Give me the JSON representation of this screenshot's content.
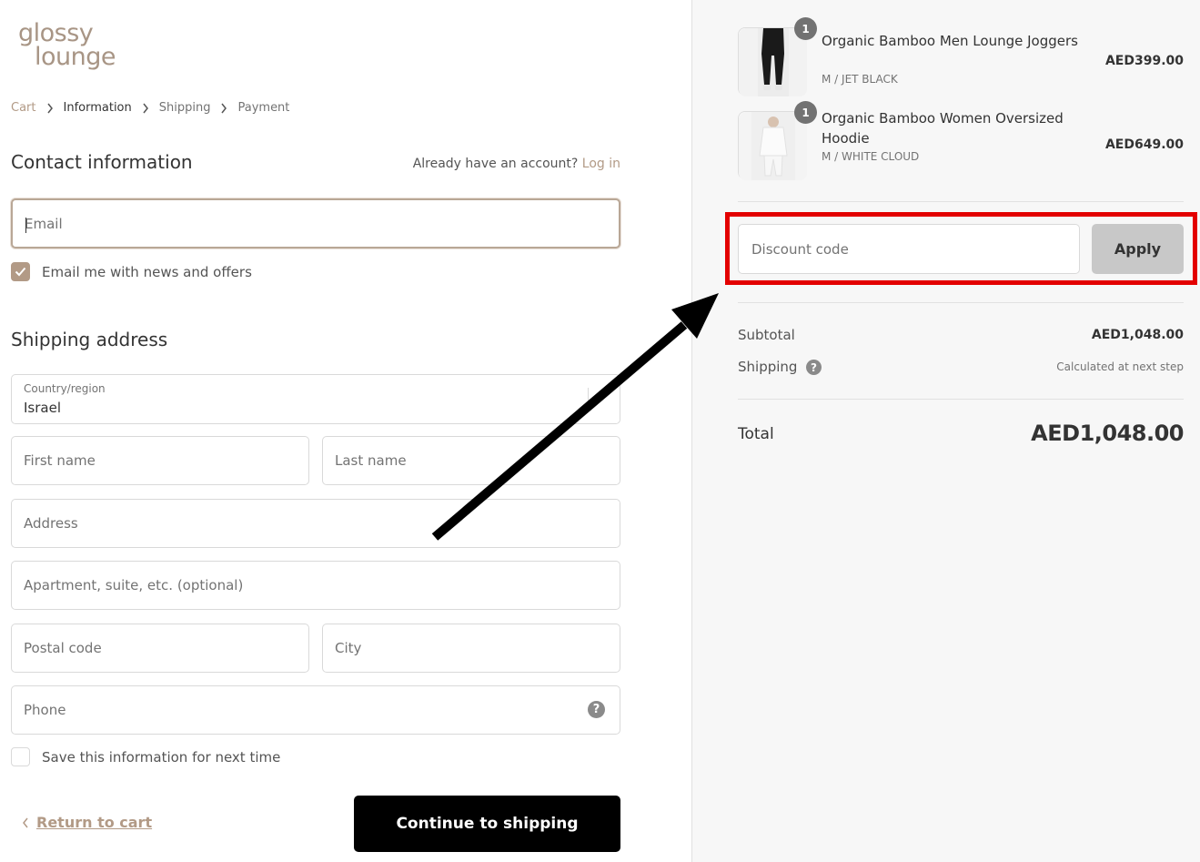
{
  "logo": {
    "line1": "glossy",
    "line2": "lounge"
  },
  "breadcrumb": [
    "Cart",
    "Information",
    "Shipping",
    "Payment"
  ],
  "contact": {
    "title": "Contact information",
    "login_prompt": "Already have an account?",
    "login_link": "Log in",
    "email_placeholder": "Email",
    "newsletter_label": "Email me with news and offers",
    "newsletter_checked": true
  },
  "shipping": {
    "title": "Shipping address",
    "country_label": "Country/region",
    "country_value": "Israel",
    "first_name_placeholder": "First name",
    "last_name_placeholder": "Last name",
    "address_placeholder": "Address",
    "apartment_placeholder": "Apartment, suite, etc. (optional)",
    "postal_placeholder": "Postal code",
    "city_placeholder": "City",
    "phone_placeholder": "Phone",
    "save_info_label": "Save this information for next time",
    "save_info_checked": false
  },
  "footer": {
    "return_label": "Return to cart",
    "continue_label": "Continue to shipping"
  },
  "order": {
    "items": [
      {
        "name": "Organic Bamboo Men Lounge Joggers",
        "variant": "M / JET BLACK",
        "price": "AED399.00",
        "qty": "1"
      },
      {
        "name": "Organic Bamboo Women Oversized Hoodie",
        "variant": "M / WHITE CLOUD",
        "price": "AED649.00",
        "qty": "1"
      }
    ],
    "discount_placeholder": "Discount code",
    "apply_label": "Apply",
    "subtotal_label": "Subtotal",
    "subtotal_value": "AED1,048.00",
    "shipping_label": "Shipping",
    "shipping_value": "Calculated at next step",
    "total_label": "Total",
    "total_value": "AED1,048.00"
  },
  "colors": {
    "accent": "#b29a86",
    "highlight_box": "#e30000",
    "arrow": "#000000",
    "button_primary": "#000000",
    "button_disabled": "#c8c8c8"
  }
}
